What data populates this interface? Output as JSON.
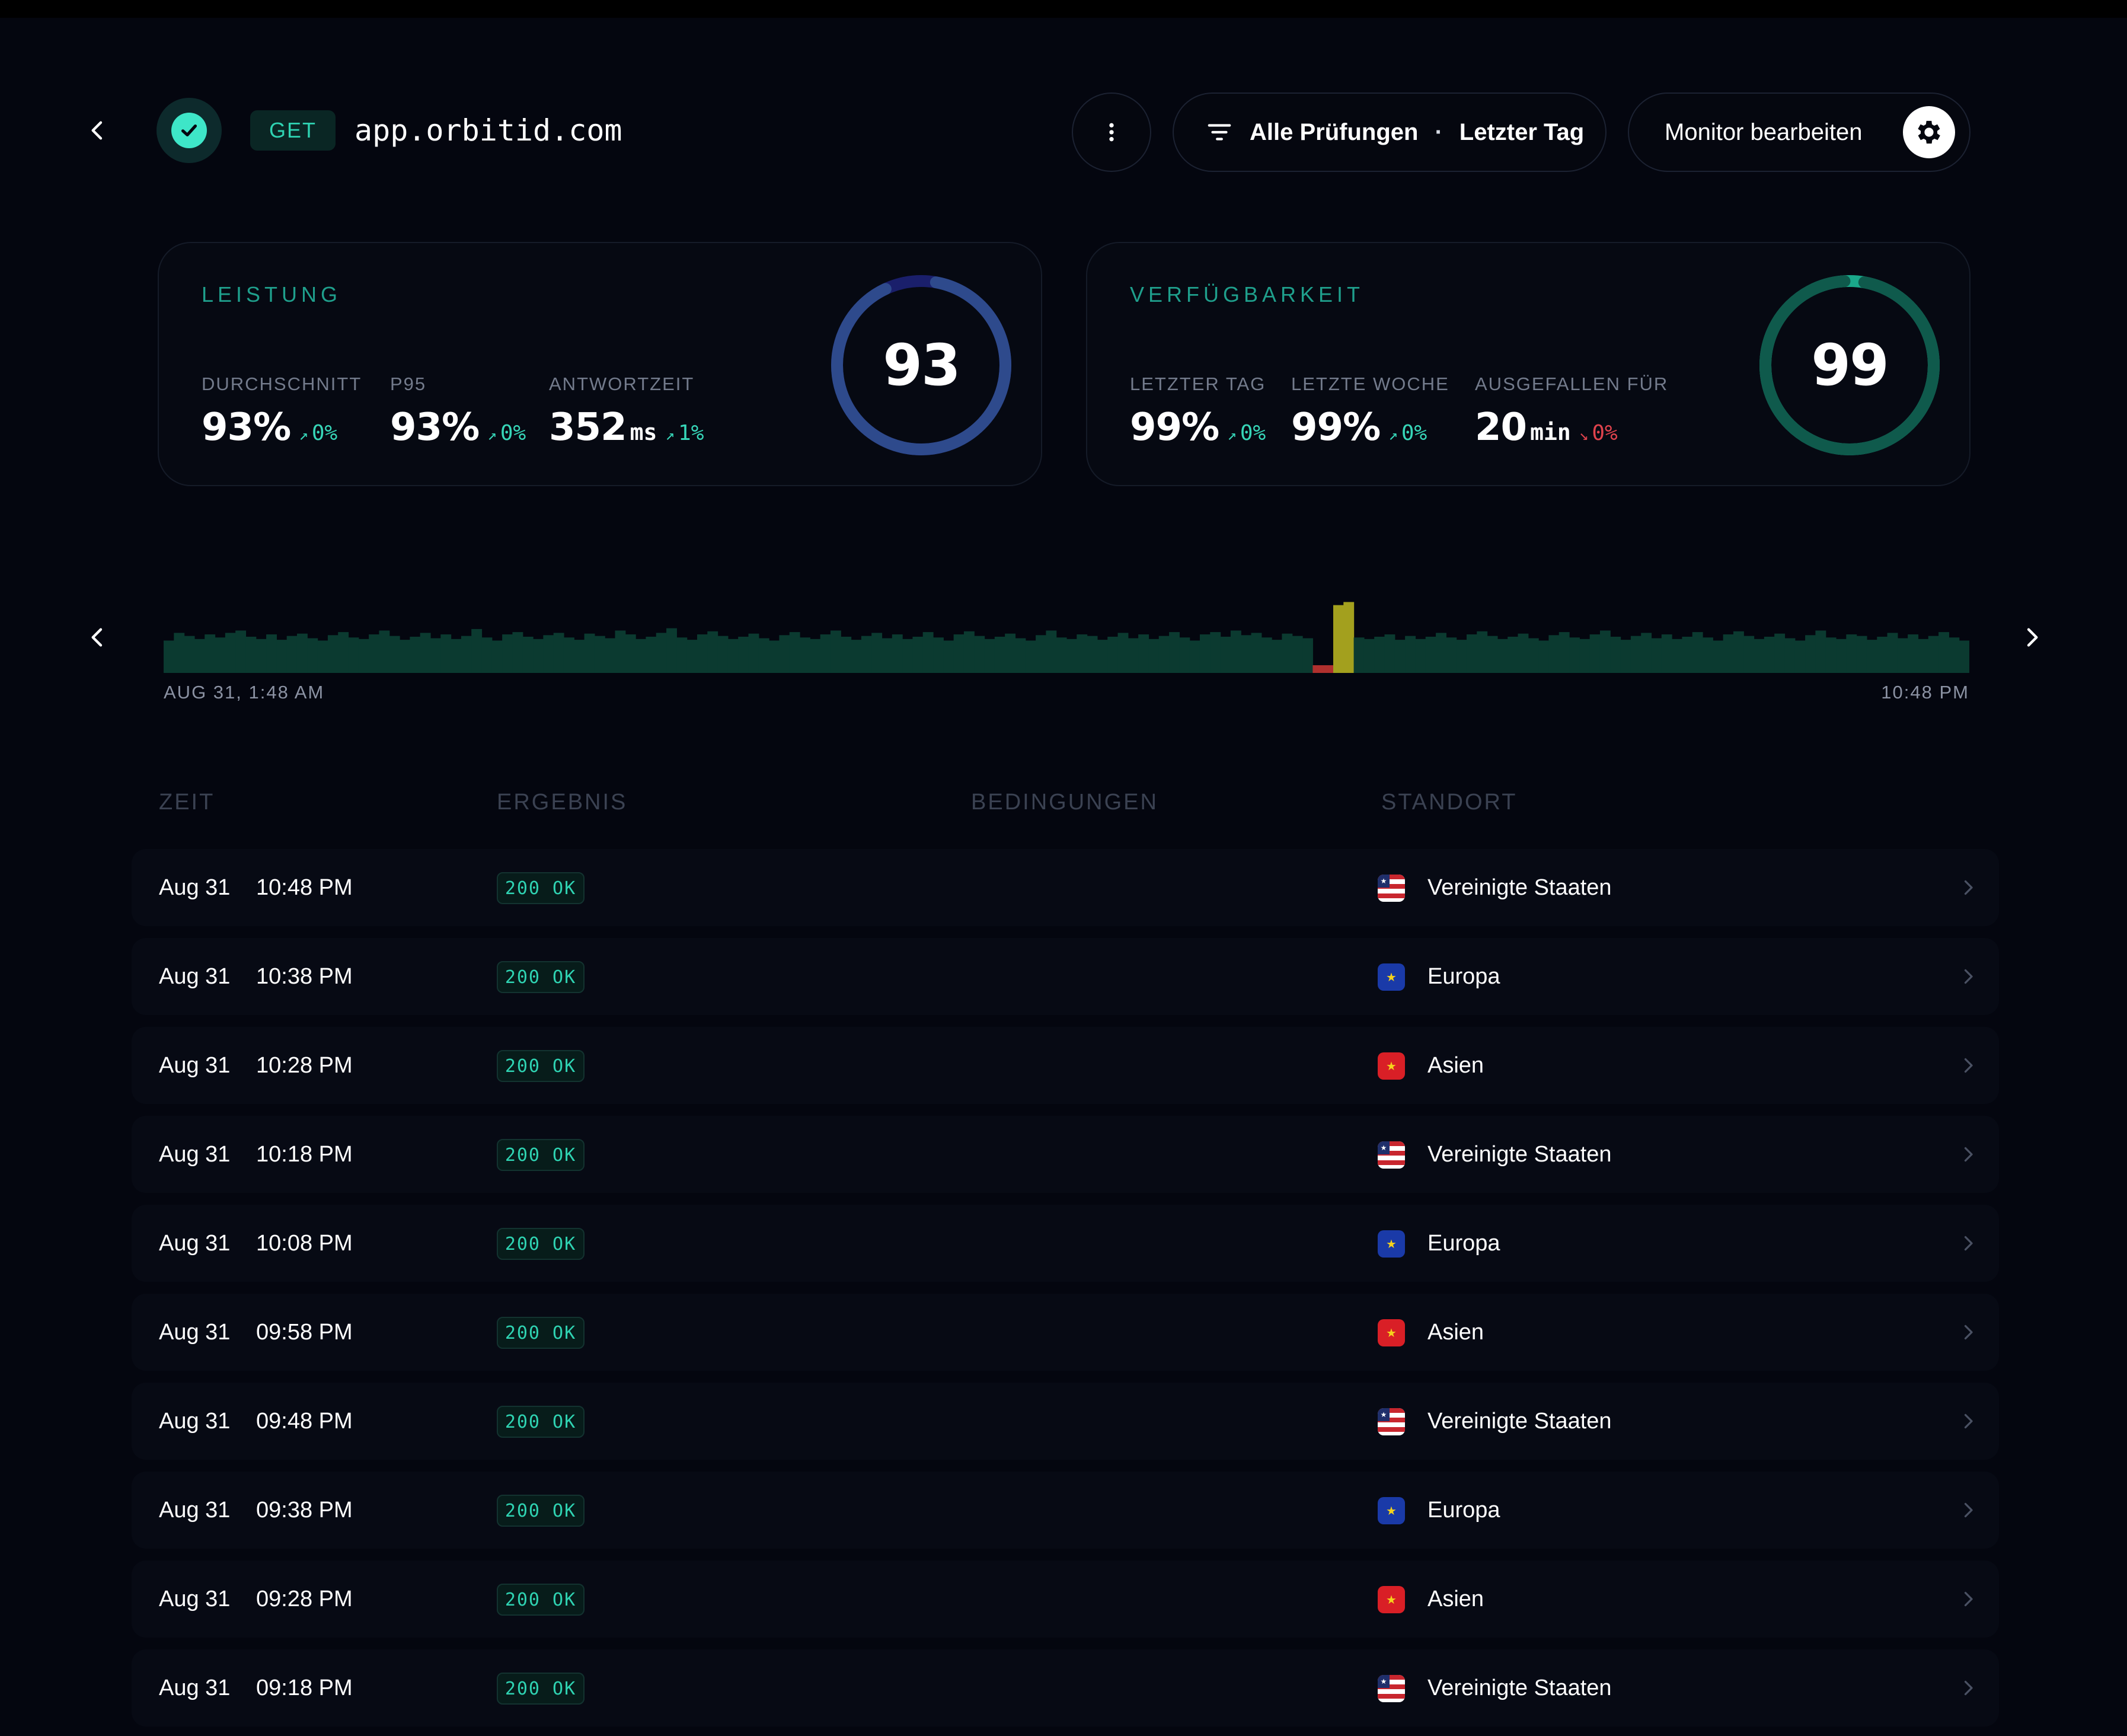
{
  "header": {
    "method": "GET",
    "url": "app.orbitid.com",
    "filter_label": "Alle Prüfungen",
    "filter_separator": "·",
    "filter_range": "Letzter Tag",
    "edit_label": "Monitor bearbeiten"
  },
  "icons": {
    "back": "chevron-left-icon",
    "status": "check-icon",
    "more": "more-vertical-icon",
    "filter": "filter-icon",
    "settings": "gear-icon",
    "row_open": "chevron-right-icon"
  },
  "colors": {
    "background": "#04060f",
    "accent": "#2fd3b2",
    "perf_ring": "#2e4a8c",
    "perf_ring_gap": "#1a1f6b",
    "avail_ring": "#0f5a4c",
    "avail_ring_gap": "#1aa88a",
    "down": "#e0434d",
    "bar_ok": "#0b3a30",
    "bar_warn": "#a3a01e",
    "bar_err": "#b0302e"
  },
  "performance": {
    "title": "LEISTUNG",
    "score": 93,
    "metrics": [
      {
        "label": "DURCHSCHNITT",
        "value": "93%",
        "unit": "",
        "delta": "0%",
        "trend": "up"
      },
      {
        "label": "P95",
        "value": "93%",
        "unit": "",
        "delta": "0%",
        "trend": "up"
      },
      {
        "label": "ANTWORTZEIT",
        "value": "352",
        "unit": "ms",
        "delta": "1%",
        "trend": "up"
      }
    ]
  },
  "availability": {
    "title": "VERFÜGBARKEIT",
    "score": 99,
    "metrics": [
      {
        "label": "LETZTER TAG",
        "value": "99%",
        "unit": "",
        "delta": "0%",
        "trend": "up"
      },
      {
        "label": "LETZTE WOCHE",
        "value": "99%",
        "unit": "",
        "delta": "0%",
        "trend": "up"
      },
      {
        "label": "AUSGEFALLEN FÜR",
        "value": "20",
        "unit": "min",
        "delta": "0%",
        "trend": "down"
      }
    ]
  },
  "timeline": {
    "start_label": "AUG 31, 1:48 AM",
    "end_label": "10:48 PM",
    "chart_data": {
      "type": "bar",
      "values": [
        0.42,
        0.52,
        0.48,
        0.44,
        0.5,
        0.46,
        0.52,
        0.55,
        0.47,
        0.44,
        0.5,
        0.43,
        0.48,
        0.51,
        0.45,
        0.42,
        0.49,
        0.53,
        0.46,
        0.44,
        0.5,
        0.55,
        0.48,
        0.43,
        0.47,
        0.52,
        0.45,
        0.5,
        0.44,
        0.48,
        0.57,
        0.46,
        0.42,
        0.5,
        0.53,
        0.47,
        0.44,
        0.49,
        0.52,
        0.46,
        0.43,
        0.51,
        0.48,
        0.45,
        0.55,
        0.5,
        0.44,
        0.47,
        0.52,
        0.58,
        0.46,
        0.43,
        0.5,
        0.54,
        0.48,
        0.44,
        0.47,
        0.51,
        0.45,
        0.42,
        0.49,
        0.53,
        0.46,
        0.44,
        0.5,
        0.55,
        0.47,
        0.43,
        0.48,
        0.52,
        0.45,
        0.5,
        0.44,
        0.47,
        0.53,
        0.46,
        0.42,
        0.5,
        0.54,
        0.48,
        0.44,
        0.47,
        0.51,
        0.45,
        0.42,
        0.49,
        0.55,
        0.46,
        0.44,
        0.5,
        0.48,
        0.43,
        0.47,
        0.52,
        0.45,
        0.5,
        0.44,
        0.48,
        0.53,
        0.46,
        0.42,
        0.5,
        0.53,
        0.47,
        0.55,
        0.49,
        0.52,
        0.46,
        0.43,
        0.51,
        0.48,
        0.45,
        0.1,
        0.1,
        0.88,
        0.92,
        0.46,
        0.44,
        0.47,
        0.5,
        0.43,
        0.48,
        0.44,
        0.47,
        0.52,
        0.46,
        0.43,
        0.5,
        0.54,
        0.48,
        0.44,
        0.47,
        0.51,
        0.45,
        0.42,
        0.49,
        0.53,
        0.46,
        0.44,
        0.5,
        0.55,
        0.47,
        0.43,
        0.48,
        0.52,
        0.45,
        0.5,
        0.44,
        0.47,
        0.53,
        0.46,
        0.42,
        0.5,
        0.54,
        0.48,
        0.44,
        0.47,
        0.51,
        0.45,
        0.42,
        0.49,
        0.55,
        0.46,
        0.44,
        0.5,
        0.48,
        0.43,
        0.47,
        0.52,
        0.45,
        0.5,
        0.44,
        0.48,
        0.53,
        0.46,
        0.42
      ],
      "status": {
        "error_indices": [
          112,
          113
        ],
        "warn_indices": [
          114,
          115
        ]
      }
    }
  },
  "table": {
    "headers": {
      "time": "ZEIT",
      "result": "ERGEBNIS",
      "conditions": "BEDINGUNGEN",
      "location": "STANDORT"
    },
    "rows": [
      {
        "date": "Aug 31",
        "time": "10:48 PM",
        "status": "200 OK",
        "flag": "us",
        "location": "Vereinigte Staaten"
      },
      {
        "date": "Aug 31",
        "time": "10:38 PM",
        "status": "200 OK",
        "flag": "eu",
        "location": "Europa"
      },
      {
        "date": "Aug 31",
        "time": "10:28 PM",
        "status": "200 OK",
        "flag": "asia",
        "location": "Asien"
      },
      {
        "date": "Aug 31",
        "time": "10:18 PM",
        "status": "200 OK",
        "flag": "us",
        "location": "Vereinigte Staaten"
      },
      {
        "date": "Aug 31",
        "time": "10:08 PM",
        "status": "200 OK",
        "flag": "eu",
        "location": "Europa"
      },
      {
        "date": "Aug 31",
        "time": "09:58 PM",
        "status": "200 OK",
        "flag": "asia",
        "location": "Asien"
      },
      {
        "date": "Aug 31",
        "time": "09:48 PM",
        "status": "200 OK",
        "flag": "us",
        "location": "Vereinigte Staaten"
      },
      {
        "date": "Aug 31",
        "time": "09:38 PM",
        "status": "200 OK",
        "flag": "eu",
        "location": "Europa"
      },
      {
        "date": "Aug 31",
        "time": "09:28 PM",
        "status": "200 OK",
        "flag": "asia",
        "location": "Asien"
      },
      {
        "date": "Aug 31",
        "time": "09:18 PM",
        "status": "200 OK",
        "flag": "us",
        "location": "Vereinigte Staaten"
      }
    ]
  }
}
